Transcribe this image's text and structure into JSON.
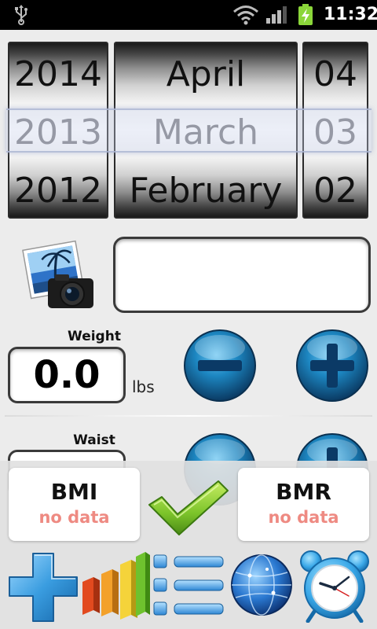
{
  "status_bar": {
    "time": "11:32",
    "icons": [
      "usb-icon",
      "wifi-icon",
      "signal-icon",
      "battery-charging-icon"
    ]
  },
  "date_picker": {
    "year": {
      "above": "2014",
      "selected": "2013",
      "below": "2012"
    },
    "month": {
      "above": "April",
      "selected": "March",
      "below": "February"
    },
    "day": {
      "above": "04",
      "selected": "03",
      "below": "02"
    }
  },
  "note": {
    "value": ""
  },
  "weight": {
    "label": "Weight",
    "value": "0.0",
    "unit": "lbs"
  },
  "waist": {
    "label": "Waist"
  },
  "stats": {
    "bmi": {
      "title": "BMI",
      "value": "no data"
    },
    "bmr": {
      "title": "BMR",
      "value": "no data"
    }
  },
  "toolbar_icons": [
    "add-icon",
    "bar-chart-icon",
    "list-icon",
    "globe-icon",
    "alarm-clock-icon"
  ],
  "colors": {
    "button_blue": "#1d87c2",
    "check_green": "#7cc42a",
    "no_data": "#ee8a82"
  }
}
